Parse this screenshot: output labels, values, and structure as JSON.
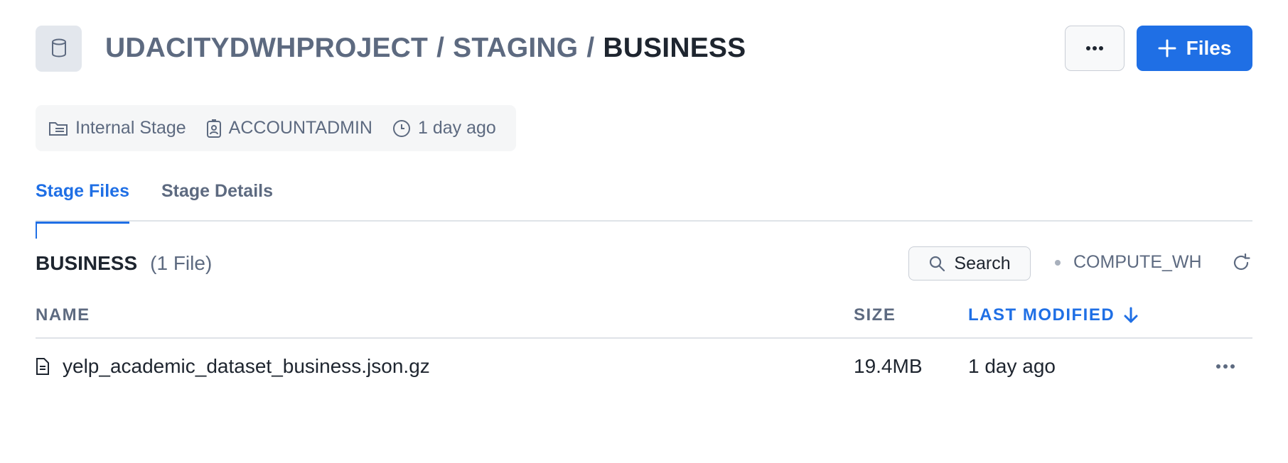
{
  "header": {
    "breadcrumb": [
      "UDACITYDWHPROJECT",
      "STAGING",
      "BUSINESS"
    ],
    "separator": "/",
    "files_button_label": "Files"
  },
  "meta": {
    "stage_type": "Internal Stage",
    "owner": "ACCOUNTADMIN",
    "created": "1 day ago"
  },
  "tabs": [
    {
      "label": "Stage Files",
      "active": true
    },
    {
      "label": "Stage Details",
      "active": false
    }
  ],
  "section": {
    "title": "BUSINESS",
    "count": "(1 File)"
  },
  "toolbar": {
    "search_label": "Search",
    "warehouse": "COMPUTE_WH"
  },
  "table": {
    "columns": [
      "NAME",
      "SIZE",
      "LAST MODIFIED"
    ],
    "sort_column": "LAST MODIFIED",
    "sort_direction": "desc",
    "rows": [
      {
        "name": "yelp_academic_dataset_business.json.gz",
        "size": "19.4MB",
        "last_modified": "1 day ago"
      }
    ]
  },
  "colors": {
    "accent": "#1f6fe5",
    "muted_text": "#5d6a80",
    "primary_text": "#1e252f"
  },
  "icons": {
    "entity": "database-icon",
    "more": "ellipsis-icon",
    "add": "plus-icon",
    "stage": "folder-stage-icon",
    "owner": "user-badge-icon",
    "time": "clock-icon",
    "search": "search-icon",
    "refresh": "refresh-icon",
    "sort": "arrow-down-icon",
    "file": "file-icon"
  }
}
